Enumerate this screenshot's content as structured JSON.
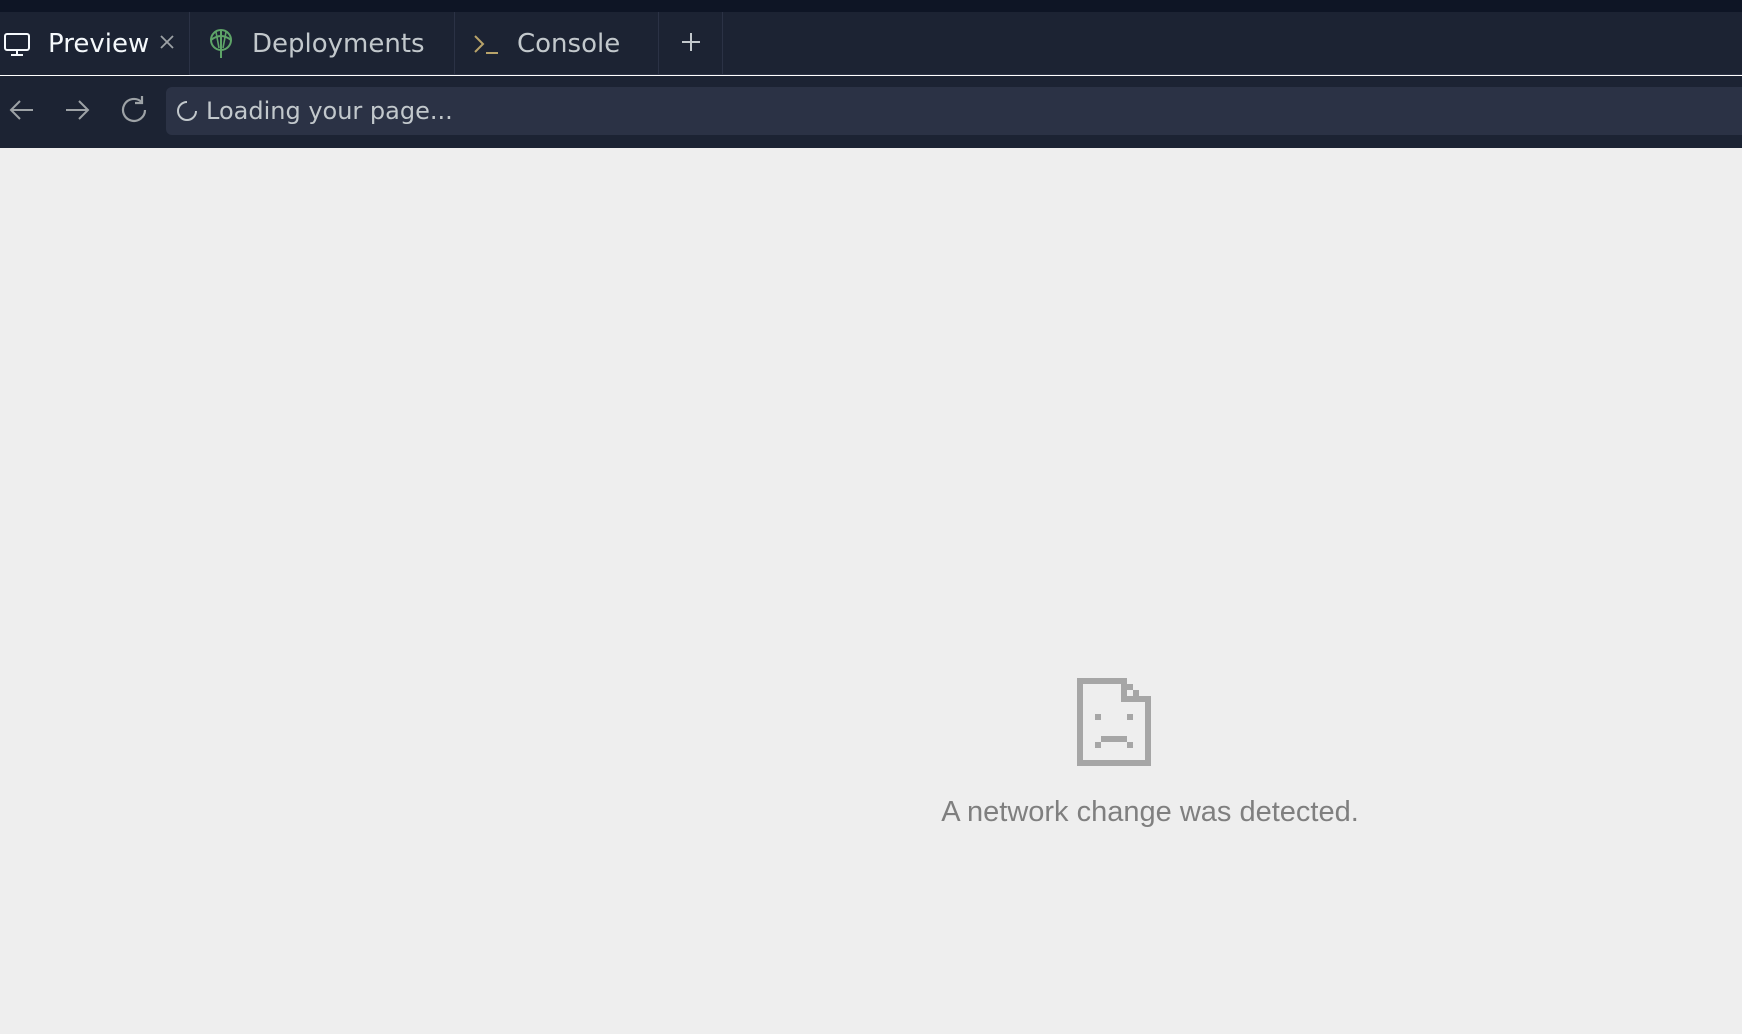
{
  "tabs": [
    {
      "label": "Preview",
      "icon": "monitor-icon",
      "active": true
    },
    {
      "label": "Deployments",
      "icon": "deployments-icon",
      "active": false
    },
    {
      "label": "Console",
      "icon": "terminal-icon",
      "active": false
    }
  ],
  "new_tab_icon": "plus-icon",
  "navigation": {
    "back_icon": "arrow-left-icon",
    "forward_icon": "arrow-right-icon",
    "reload_icon": "reload-icon"
  },
  "address_bar": {
    "status_text": "Loading your page...",
    "status_icon": "loading-spinner-icon"
  },
  "error": {
    "icon": "sad-document-icon",
    "message": "A network change was detected."
  },
  "colors": {
    "tab_bar_bg": "#1c2333",
    "top_strip_bg": "#0e1525",
    "urlbar_bg": "#2b3245",
    "content_bg": "#eeeeee",
    "error_text": "#7f7f7f",
    "deployments_icon": "#5ea468",
    "console_icon": "#b8a36a"
  }
}
